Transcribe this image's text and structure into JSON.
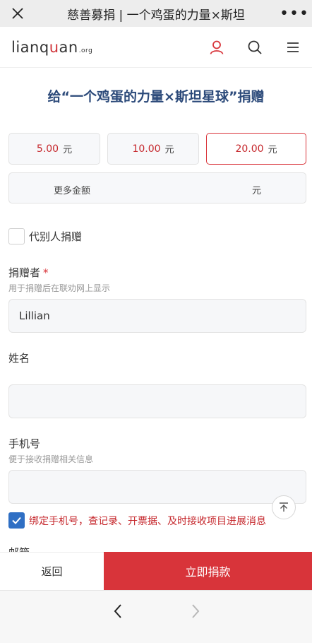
{
  "titlebar": {
    "title": "慈善募捐 | 一个鸡蛋的力量×斯坦",
    "more": "•••"
  },
  "header": {
    "logo": {
      "part1": "lianq",
      "part2": "u",
      "part3": "an",
      "suffix": ".org"
    }
  },
  "page": {
    "heading": "给“一个鸡蛋的力量×斯坦星球”捐赠"
  },
  "amounts": [
    {
      "value": "5.00",
      "unit": "元",
      "selected": false
    },
    {
      "value": "10.00",
      "unit": "元",
      "selected": false
    },
    {
      "value": "20.00",
      "unit": "元",
      "selected": true
    }
  ],
  "more_amount": {
    "label": "更多金额",
    "unit": "元"
  },
  "proxy_donation": {
    "label": "代别人捐赠",
    "checked": false
  },
  "donor": {
    "label": "捐赠者",
    "required_mark": "*",
    "hint": "用于捐赠后在联劝网上显示",
    "value": "Lillian"
  },
  "name": {
    "label": "姓名",
    "value": ""
  },
  "phone": {
    "label": "手机号",
    "hint": "便于接收捐赠相关信息",
    "value": ""
  },
  "bind_phone": {
    "label": "绑定手机号，查记录、开票据、及时接收项目进展消息",
    "checked": true
  },
  "email": {
    "label": "邮箱"
  },
  "actions": {
    "back": "返回",
    "donate": "立即捐款"
  },
  "colors": {
    "accent_red": "#d8343a",
    "heading_blue": "#2c4a7a",
    "check_blue": "#2f6fc4"
  }
}
